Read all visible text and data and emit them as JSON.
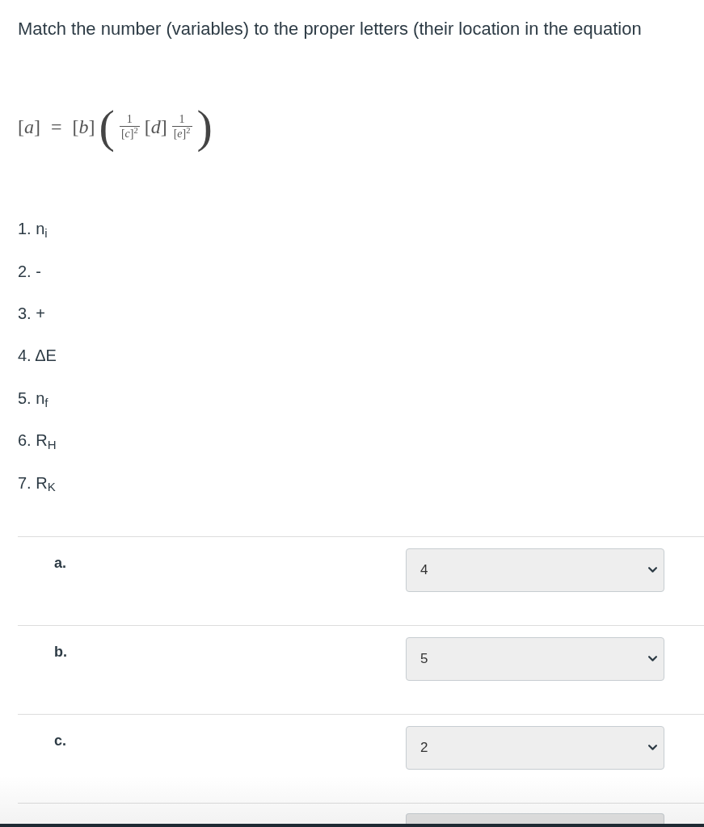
{
  "question": {
    "prompt": "Match the number (variables) to the proper letters (their location in the equation"
  },
  "equation": {
    "left": "[*a*]",
    "equals": "=",
    "coefficient": "[*b*]",
    "open_paren": "(",
    "fraction_1": {
      "numerator": "1",
      "denominator": "[*c*]$^{2}$"
    },
    "middle": "[*d*]",
    "fraction_2": {
      "numerator": "1",
      "denominator": "[*e*]$^{2}$"
    },
    "close_paren": ")"
  },
  "options": [
    "1. n$_{i}$",
    "2. -",
    "3. +",
    "4. ΔE",
    "5. n$_{f}$",
    "6. R$_{H}$",
    "7. R$_{K}$"
  ],
  "matches": [
    {
      "kind": "match",
      "label": "a.",
      "value": "4"
    },
    {
      "kind": "match",
      "label": "b.",
      "value": "5"
    },
    {
      "kind": "match",
      "label": "c.",
      "value": "2"
    },
    {
      "kind": "cut_off"
    }
  ]
}
